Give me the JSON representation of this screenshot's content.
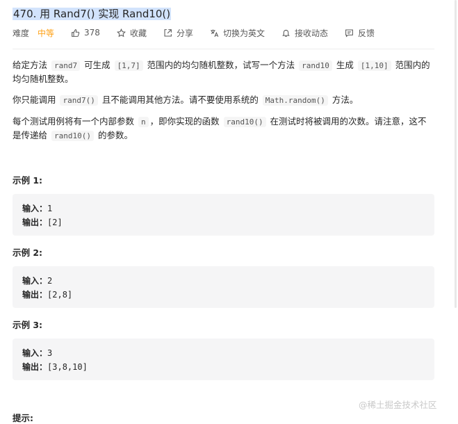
{
  "problem": {
    "title": "470. 用 Rand7() 实现 Rand10()",
    "difficulty_label": "难度",
    "difficulty": "中等",
    "likes": "378",
    "favorite_label": "收藏",
    "share_label": "分享",
    "switch_lang_label": "切换为英文",
    "notify_label": "接收动态",
    "feedback_label": "反馈"
  },
  "description": {
    "p1": [
      {
        "text": "给定方法 "
      },
      {
        "code": "rand7"
      },
      {
        "text": " 可生成 "
      },
      {
        "code": "[1,7]"
      },
      {
        "text": " 范围内的均匀随机整数，试写一个方法 "
      },
      {
        "code": "rand10"
      },
      {
        "text": " 生成 "
      },
      {
        "code": "[1,10]"
      },
      {
        "text": " 范围内的均匀随机整数。"
      }
    ],
    "p2": [
      {
        "text": "你只能调用 "
      },
      {
        "code": "rand7()"
      },
      {
        "text": " 且不能调用其他方法。请不要使用系统的 "
      },
      {
        "code": "Math.random()"
      },
      {
        "text": " 方法。"
      }
    ],
    "p3": [
      {
        "text": "每个测试用例将有一个内部参数 "
      },
      {
        "code": "n"
      },
      {
        "text": "，即你实现的函数 "
      },
      {
        "code": "rand10()"
      },
      {
        "text": " 在测试时将被调用的次数。请注意，这不是传递给 "
      },
      {
        "code": "rand10()"
      },
      {
        "text": " 的参数。"
      }
    ]
  },
  "examples": [
    {
      "title": "示例 1:",
      "input_label": "输入：",
      "input": "1",
      "output_label": "输出：",
      "output": "[2]"
    },
    {
      "title": "示例 2:",
      "input_label": "输入：",
      "input": "2",
      "output_label": "输出：",
      "output": "[2,8]"
    },
    {
      "title": "示例 3:",
      "input_label": "输入：",
      "input": "3",
      "output_label": "输出：",
      "output": "[3,8,10]"
    }
  ],
  "hints_title": "提示:",
  "watermark": "@稀土掘金技术社区"
}
